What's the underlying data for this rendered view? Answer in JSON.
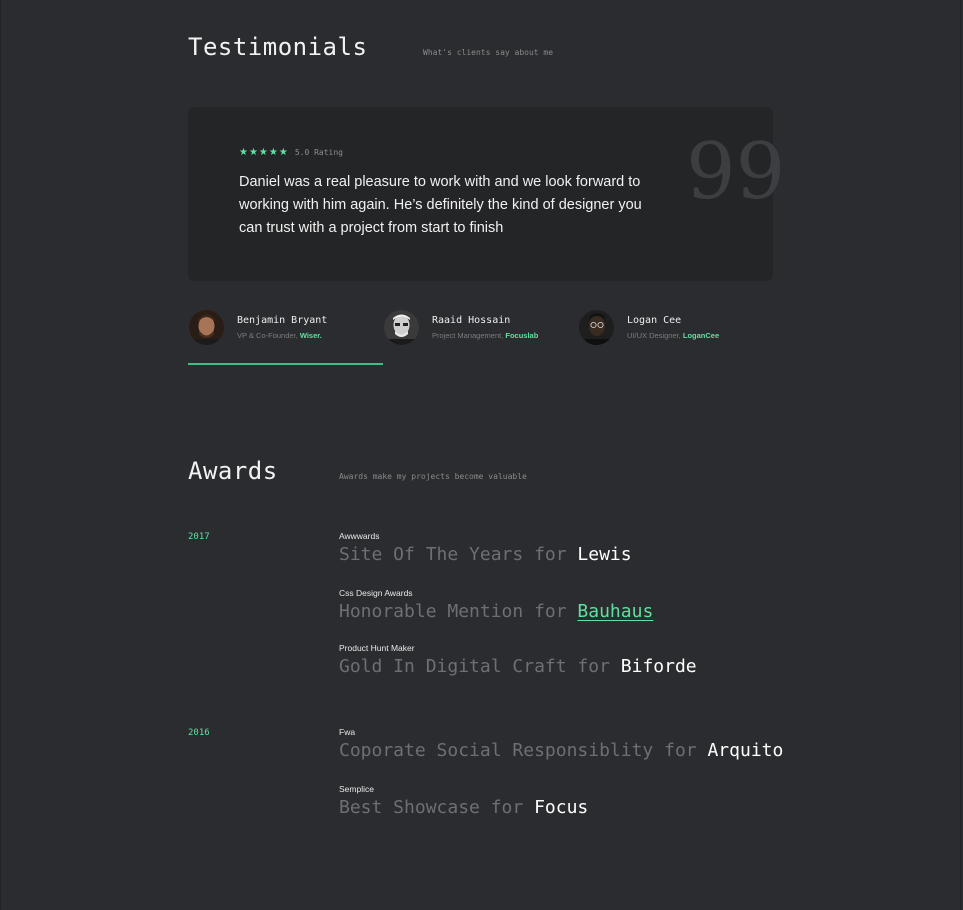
{
  "testimonials": {
    "title": "Testimonials",
    "subtitle": "What's clients say about me",
    "rating": {
      "stars": "★★★★★",
      "text": "5.0 Rating"
    },
    "quote": "Daniel was a real pleasure to work with and we look forward to working with him again. He’s definitely the kind of designer you can trust with a project from start to finish",
    "quote_mark": "99",
    "people": [
      {
        "name": "Benjamin Bryant",
        "role": "VP & Co-Founder,",
        "company": "Wiser."
      },
      {
        "name": "Raaid Hossain",
        "role": "Project Management,",
        "company": "Focuslab"
      },
      {
        "name": "Logan Cee",
        "role": "UI/UX Designer,",
        "company": "LoganCee"
      }
    ]
  },
  "awards": {
    "title": "Awards",
    "subtitle": "Awards make my projects become valuable",
    "years": [
      "2017",
      "2016"
    ],
    "items": [
      {
        "org": "Awwwards",
        "title": "Site Of The Years for",
        "project": "Lewis"
      },
      {
        "org": "Css Design Awards",
        "title": "Honorable Mention for",
        "project": "Bauhaus"
      },
      {
        "org": "Product Hunt Maker",
        "title": "Gold In Digital Craft for",
        "project": "Biforde"
      },
      {
        "org": "Fwa",
        "title": "Coporate Social Responsiblity for",
        "project": "Arquito"
      },
      {
        "org": "Semplice",
        "title": "Best Showcase for",
        "project": "Focus"
      }
    ]
  },
  "colors": {
    "accent": "#5fe0a0",
    "background": "#2b2c2f",
    "card": "#242527"
  }
}
